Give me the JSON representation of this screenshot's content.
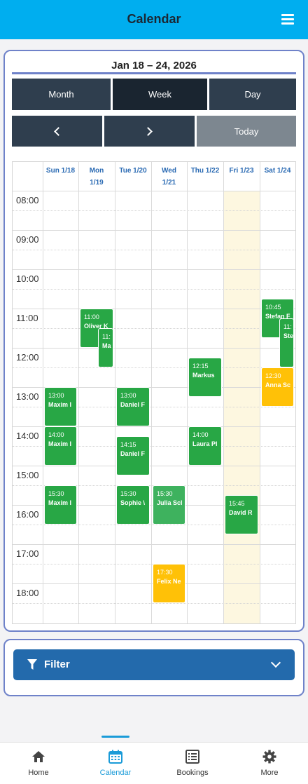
{
  "app": {
    "title": "Calendar",
    "menu_icon": "hamburger-icon"
  },
  "calendar": {
    "range_title": "Jan 18 – 24, 2026",
    "views": [
      {
        "label": "Month",
        "active": false
      },
      {
        "label": "Week",
        "active": true
      },
      {
        "label": "Day",
        "active": false
      }
    ],
    "nav": {
      "prev_icon": "chevron-left-icon",
      "next_icon": "chevron-right-icon",
      "today_label": "Today"
    },
    "days": [
      {
        "line1": "Sun 1/18",
        "line2": ""
      },
      {
        "line1": "Mon",
        "line2": "1/19"
      },
      {
        "line1": "Tue 1/20",
        "line2": ""
      },
      {
        "line1": "Wed",
        "line2": "1/21"
      },
      {
        "line1": "Thu 1/22",
        "line2": ""
      },
      {
        "line1": "Fri 1/23",
        "line2": ""
      },
      {
        "line1": "Sat 1/24",
        "line2": ""
      }
    ],
    "today_day_index": 5,
    "hours": [
      "08:00",
      "09:00",
      "10:00",
      "11:00",
      "12:00",
      "13:00",
      "14:00",
      "15:00",
      "16:00",
      "17:00",
      "18:00"
    ],
    "colors": {
      "confirmed": "#28a745",
      "confirmed_light": "#3eb25e",
      "pending": "#ffc107",
      "today_bg": "#fdf7e0"
    },
    "events": [
      {
        "day": 1,
        "start": "11:00",
        "end": "12:00",
        "time": "11:00",
        "name": "Oliver K",
        "status": "confirmed",
        "lane": 0,
        "lanes": 1
      },
      {
        "day": 1,
        "start": "11:30",
        "end": "12:30",
        "time": "11:",
        "name": "Ma",
        "status": "confirmed",
        "lane": 1,
        "lanes": 2
      },
      {
        "day": 6,
        "start": "10:45",
        "end": "11:45",
        "time": "10:45",
        "name": "Stefan F",
        "status": "confirmed",
        "lane": 0,
        "lanes": 1
      },
      {
        "day": 6,
        "start": "11:15",
        "end": "12:30",
        "time": "11:",
        "name": "Ste",
        "status": "confirmed",
        "lane": 1,
        "lanes": 2
      },
      {
        "day": 4,
        "start": "12:15",
        "end": "13:15",
        "time": "12:15",
        "name": "Markus",
        "status": "confirmed",
        "lane": 0,
        "lanes": 1
      },
      {
        "day": 6,
        "start": "12:30",
        "end": "13:30",
        "time": "12:30",
        "name": "Anna Sc",
        "status": "pending",
        "lane": 0,
        "lanes": 1
      },
      {
        "day": 0,
        "start": "13:00",
        "end": "14:00",
        "time": "13:00",
        "name": "Maxim I",
        "status": "confirmed",
        "lane": 0,
        "lanes": 1
      },
      {
        "day": 2,
        "start": "13:00",
        "end": "14:00",
        "time": "13:00",
        "name": "Daniel F",
        "status": "confirmed",
        "lane": 0,
        "lanes": 1
      },
      {
        "day": 0,
        "start": "14:00",
        "end": "15:00",
        "time": "14:00",
        "name": "Maxim I",
        "status": "confirmed",
        "lane": 0,
        "lanes": 1
      },
      {
        "day": 4,
        "start": "14:00",
        "end": "15:00",
        "time": "14:00",
        "name": "Laura Pl",
        "status": "confirmed",
        "lane": 0,
        "lanes": 1
      },
      {
        "day": 2,
        "start": "14:15",
        "end": "15:15",
        "time": "14:15",
        "name": "Daniel F",
        "status": "confirmed",
        "lane": 0,
        "lanes": 1
      },
      {
        "day": 0,
        "start": "15:30",
        "end": "16:30",
        "time": "15:30",
        "name": "Maxim I",
        "status": "confirmed",
        "lane": 0,
        "lanes": 1
      },
      {
        "day": 2,
        "start": "15:30",
        "end": "16:30",
        "time": "15:30",
        "name": "Sophie \\",
        "status": "confirmed",
        "lane": 0,
        "lanes": 1
      },
      {
        "day": 3,
        "start": "15:30",
        "end": "16:30",
        "time": "15:30",
        "name": "Julia Scl",
        "status": "confirmed_light",
        "lane": 0,
        "lanes": 1
      },
      {
        "day": 5,
        "start": "15:45",
        "end": "16:45",
        "time": "15:45",
        "name": "David R",
        "status": "confirmed",
        "lane": 0,
        "lanes": 1
      },
      {
        "day": 3,
        "start": "17:30",
        "end": "18:30",
        "time": "17:30",
        "name": "Felix Ne",
        "status": "pending",
        "lane": 0,
        "lanes": 1
      }
    ]
  },
  "filter": {
    "label": "Filter",
    "icon": "funnel-icon",
    "expand_icon": "chevron-down-icon"
  },
  "tabs": [
    {
      "label": "Home",
      "icon": "home-icon",
      "active": false
    },
    {
      "label": "Calendar",
      "icon": "calendar-icon",
      "active": true
    },
    {
      "label": "Bookings",
      "icon": "list-icon",
      "active": false
    },
    {
      "label": "More",
      "icon": "gear-icon",
      "active": false
    }
  ]
}
